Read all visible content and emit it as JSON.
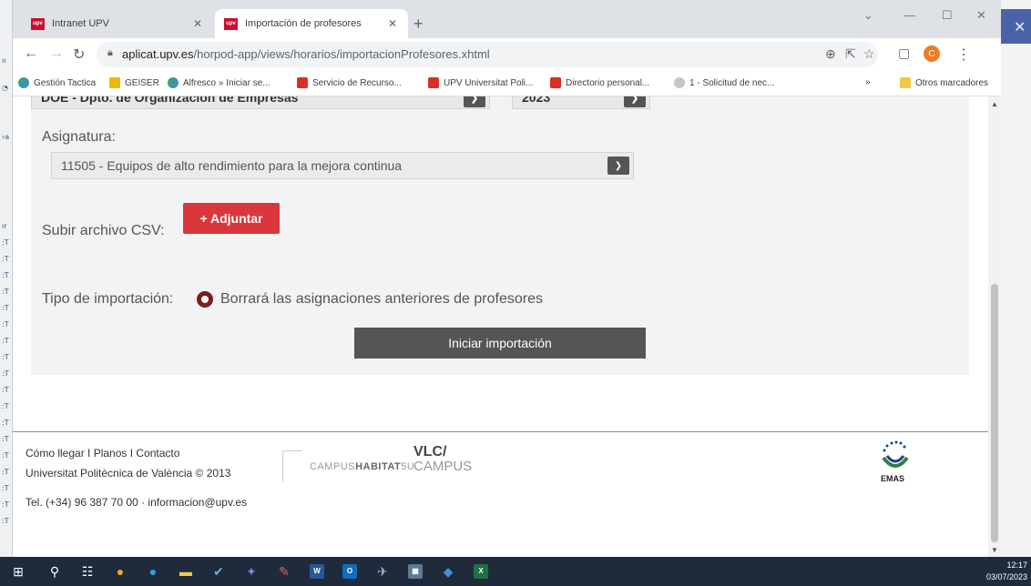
{
  "browser": {
    "tabs": [
      {
        "title": "Intranet UPV",
        "favicon": "upv"
      },
      {
        "title": "Importación de profesores",
        "favicon": "upv"
      }
    ],
    "url_host": "aplicat.upv.es",
    "url_path": "/horpod-app/views/horarios/importacionProfesores.xhtml",
    "profile_initial": "C",
    "bookmarks": [
      "Gestión Tactica",
      "GEISER",
      "Alfresco » Iniciar se...",
      "Servicio de Recurso...",
      "UPV Universitat Poli...",
      "Directorio personal...",
      "1 - Solicitud de nec...",
      "Otros marcadores"
    ],
    "bookmarks_more": "»"
  },
  "form": {
    "department_value": "DOE - Dpto. de Organización de Empresas",
    "year_value": "2023",
    "subject_label": "Asignatura:",
    "subject_value": "11505 - Equipos de alto rendimiento para la mejora continua",
    "upload_label": "Subir archivo CSV:",
    "attach_button": "+ Adjuntar",
    "import_type_label": "Tipo de importación:",
    "import_type_option": "Borrará las asignaciones anteriores de profesores",
    "import_type_selected": true,
    "start_button": "Iniciar importación"
  },
  "footer": {
    "links": "Cómo llegar I Planos I Contacto",
    "copyright": "Universitat Politècnica de València © 2013",
    "contact": "Tel. (+34) 96 387 70 00 · informacion@upv.es",
    "logo_campus_light": "CAMPUS",
    "logo_campus_bold": "HABITAT",
    "logo_campus_suffix": "5U",
    "logo_vlc_top": "VLC/",
    "logo_vlc_bottom": "CAMPUS",
    "logo_emas": "EMAS"
  },
  "taskbar": {
    "time": "12:17",
    "date": "03/07/2023"
  },
  "colors": {
    "accent_red": "#d9373b",
    "radio": "#7a1f1f",
    "dark_button": "#555555"
  }
}
